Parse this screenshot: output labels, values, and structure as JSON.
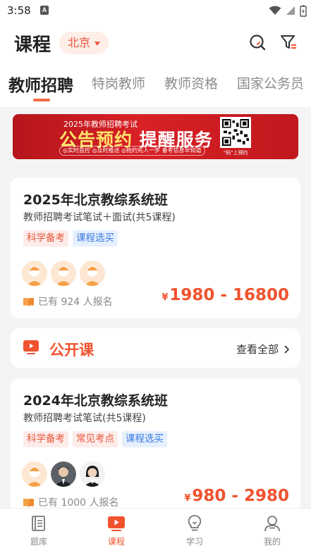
{
  "status_bar": {
    "time": "3:58",
    "app_badge": "A"
  },
  "header": {
    "title": "课程",
    "city": "北京"
  },
  "tabs": [
    {
      "label": "教师招聘"
    },
    {
      "label": "特岗教师"
    },
    {
      "label": "教师资格"
    },
    {
      "label": "国家公务员"
    }
  ],
  "banner": {
    "subtitle": "2025年教师招聘考试",
    "main_left": "公告预约",
    "main_right": "提醒服务",
    "tags": "◎实时监控  ◎及时推送  ◎抢约先人一步 备考信息早知道",
    "qr_caption": "\"码\"上预约"
  },
  "courses": [
    {
      "title": "2025年北京教综系统班",
      "subtitle": "教师招聘考试笔试＋面试(共5课程)",
      "tags": [
        {
          "label": "科学备考",
          "color": "red"
        },
        {
          "label": "课程选买",
          "color": "blue"
        }
      ],
      "enroll": "已有 924 人报名",
      "price_symbol": "¥",
      "price": "1980 - 16800"
    },
    {
      "title": "2024年北京教综系统班",
      "subtitle": "教师招聘考试笔试(共5课程)",
      "tags": [
        {
          "label": "科学备考",
          "color": "red"
        },
        {
          "label": "常见考点",
          "color": "red"
        },
        {
          "label": "课程选买",
          "color": "blue"
        }
      ],
      "enroll": "已有 1000 人报名",
      "price_symbol": "¥",
      "price": "980 - 2980"
    }
  ],
  "open_class": {
    "title": "公开课",
    "more": "查看全部"
  },
  "bottom_nav": [
    {
      "label": "题库",
      "icon": "question-bank-icon",
      "active": false
    },
    {
      "label": "课程",
      "icon": "course-play-icon",
      "active": true
    },
    {
      "label": "学习",
      "icon": "lightbulb-icon",
      "active": false
    },
    {
      "label": "我的",
      "icon": "profile-icon",
      "active": false
    }
  ],
  "colors": {
    "accent": "#f0522e",
    "tag_red_bg": "#fdecea",
    "tag_blue_bg": "#e6f0fd",
    "tag_blue_text": "#3a7be0"
  }
}
